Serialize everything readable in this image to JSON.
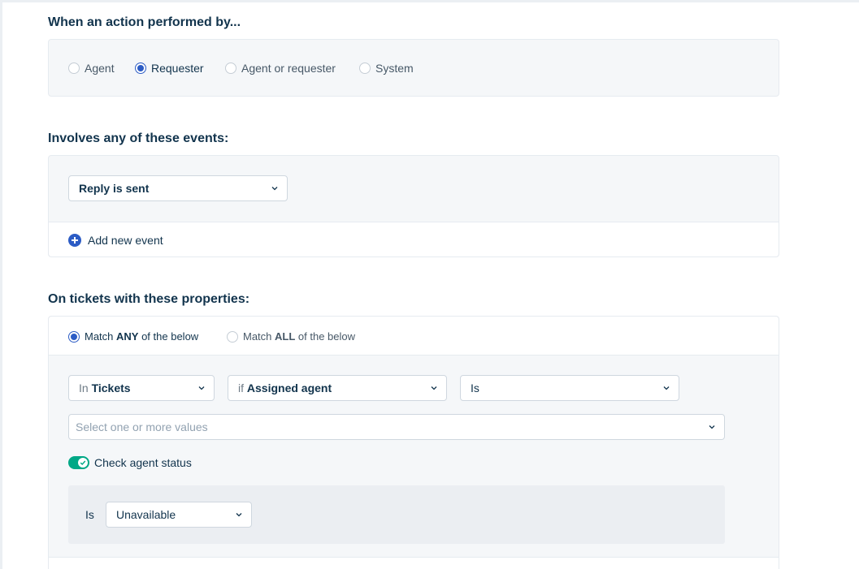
{
  "actor_section": {
    "title": "When an action performed by...",
    "options": [
      {
        "label": "Agent",
        "checked": false
      },
      {
        "label": "Requester",
        "checked": true
      },
      {
        "label": "Agent or requester",
        "checked": false
      },
      {
        "label": "System",
        "checked": false
      }
    ]
  },
  "events_section": {
    "title": "Involves any of these events:",
    "event_select": "Reply is sent",
    "add_event_label": "Add new event"
  },
  "properties_section": {
    "title": "On tickets with these properties:",
    "match_any": {
      "prefix": "Match ",
      "keyword": "ANY",
      "suffix": " of the below",
      "checked": true
    },
    "match_all": {
      "prefix": "Match ",
      "keyword": "ALL",
      "suffix": " of the below",
      "checked": false
    },
    "condition": {
      "scope_prefix": "In",
      "scope_value": "Tickets",
      "field_prefix": "if",
      "field_value": "Assigned agent",
      "operator": "Is",
      "values_placeholder": "Select one or more values"
    },
    "check_status": {
      "label": "Check agent status",
      "enabled": true
    },
    "status": {
      "operator_label": "Is",
      "value": "Unavailable"
    }
  },
  "colors": {
    "primary": "#2c5cc5",
    "toggle_on": "#00a886",
    "heading": "#12344d"
  }
}
